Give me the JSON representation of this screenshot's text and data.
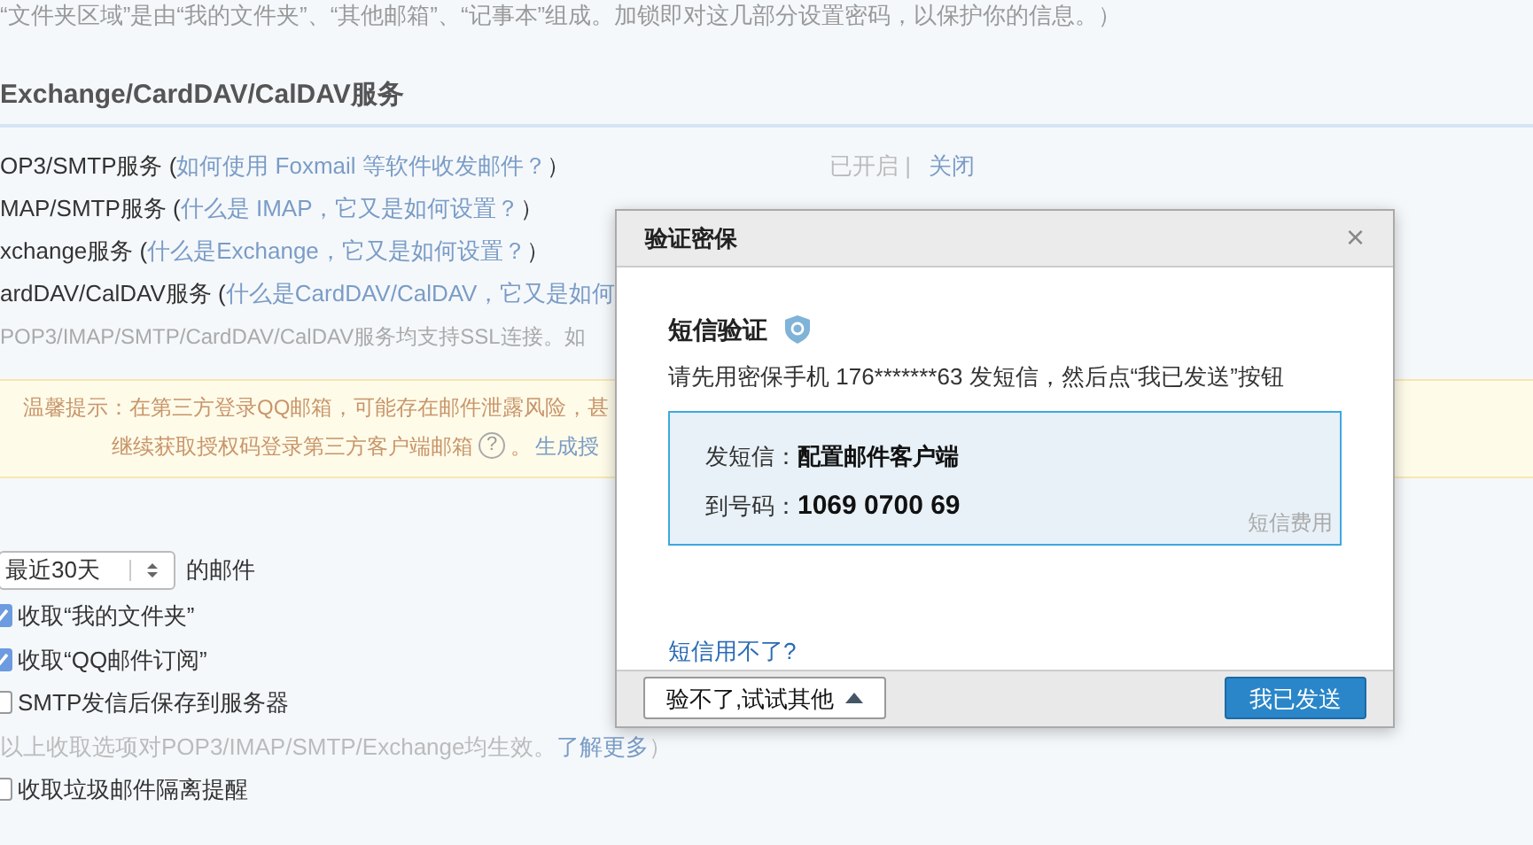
{
  "intro": "“文件夹区域”是由“我的文件夹”、“其他邮箱”、“记事本”组成。加锁即对这几部分设置密码，以保护你的信息。）",
  "section_title": "Exchange/CardDAV/CalDAV服务",
  "services": [
    {
      "name": "OP3/SMTP服务 (",
      "link": "如何使用 Foxmail 等软件收发邮件？",
      "close_paren": "）",
      "status": "已开启 |",
      "action": "关闭"
    },
    {
      "name": "MAP/SMTP服务 (",
      "link": "什么是 IMAP，它又是如何设置？",
      "close_paren": "）"
    },
    {
      "name": "xchange服务 (",
      "link": "什么是Exchange，它又是如何设置？",
      "close_paren": "）"
    },
    {
      "name": "ardDAV/CalDAV服务 (",
      "link": "什么是CardDAV/CalDAV，它又是如何"
    }
  ],
  "ssl_note": "POP3/IMAP/SMTP/CardDAV/CalDAV服务均支持SSL连接。如",
  "warning": {
    "line1": "温馨提示：在第三方登录QQ邮箱，可能存在邮件泄露风险，甚",
    "line2": "继续获取授权码登录第三方客户端邮箱",
    "help_mark": "?",
    "after_help": "。",
    "link": "生成授"
  },
  "range": {
    "value": "最近30天",
    "suffix": "的邮件"
  },
  "options": [
    {
      "kind": "checkbox",
      "label": "收取“我的文件夹”",
      "checked": true
    },
    {
      "kind": "checkbox",
      "label": "收取“QQ邮件订阅”",
      "checked": true
    },
    {
      "kind": "checkbox",
      "label": "SMTP发信后保存到服务器",
      "checked": false
    },
    {
      "kind": "note",
      "text": "以上收取选项对POP3/IMAP/SMTP/Exchange均生效。",
      "link": "了解更多",
      "tail": "）"
    },
    {
      "kind": "checkbox",
      "label": "收取垃圾邮件隔离提醒",
      "checked": false
    }
  ],
  "dialog": {
    "title": "验证密保",
    "close": "×",
    "heading": "短信验证",
    "instruction": "请先用密保手机 176*******63 发短信，然后点“我已发送”按钮",
    "sms_label": "发短信：",
    "sms_content": "配置邮件客户端",
    "number_label": "到号码：",
    "number": "1069 0700 69",
    "fee_link": "短信费用",
    "help_link": "短信用不了?",
    "other_button": "验不了,试试其他",
    "send_button": "我已发送"
  }
}
